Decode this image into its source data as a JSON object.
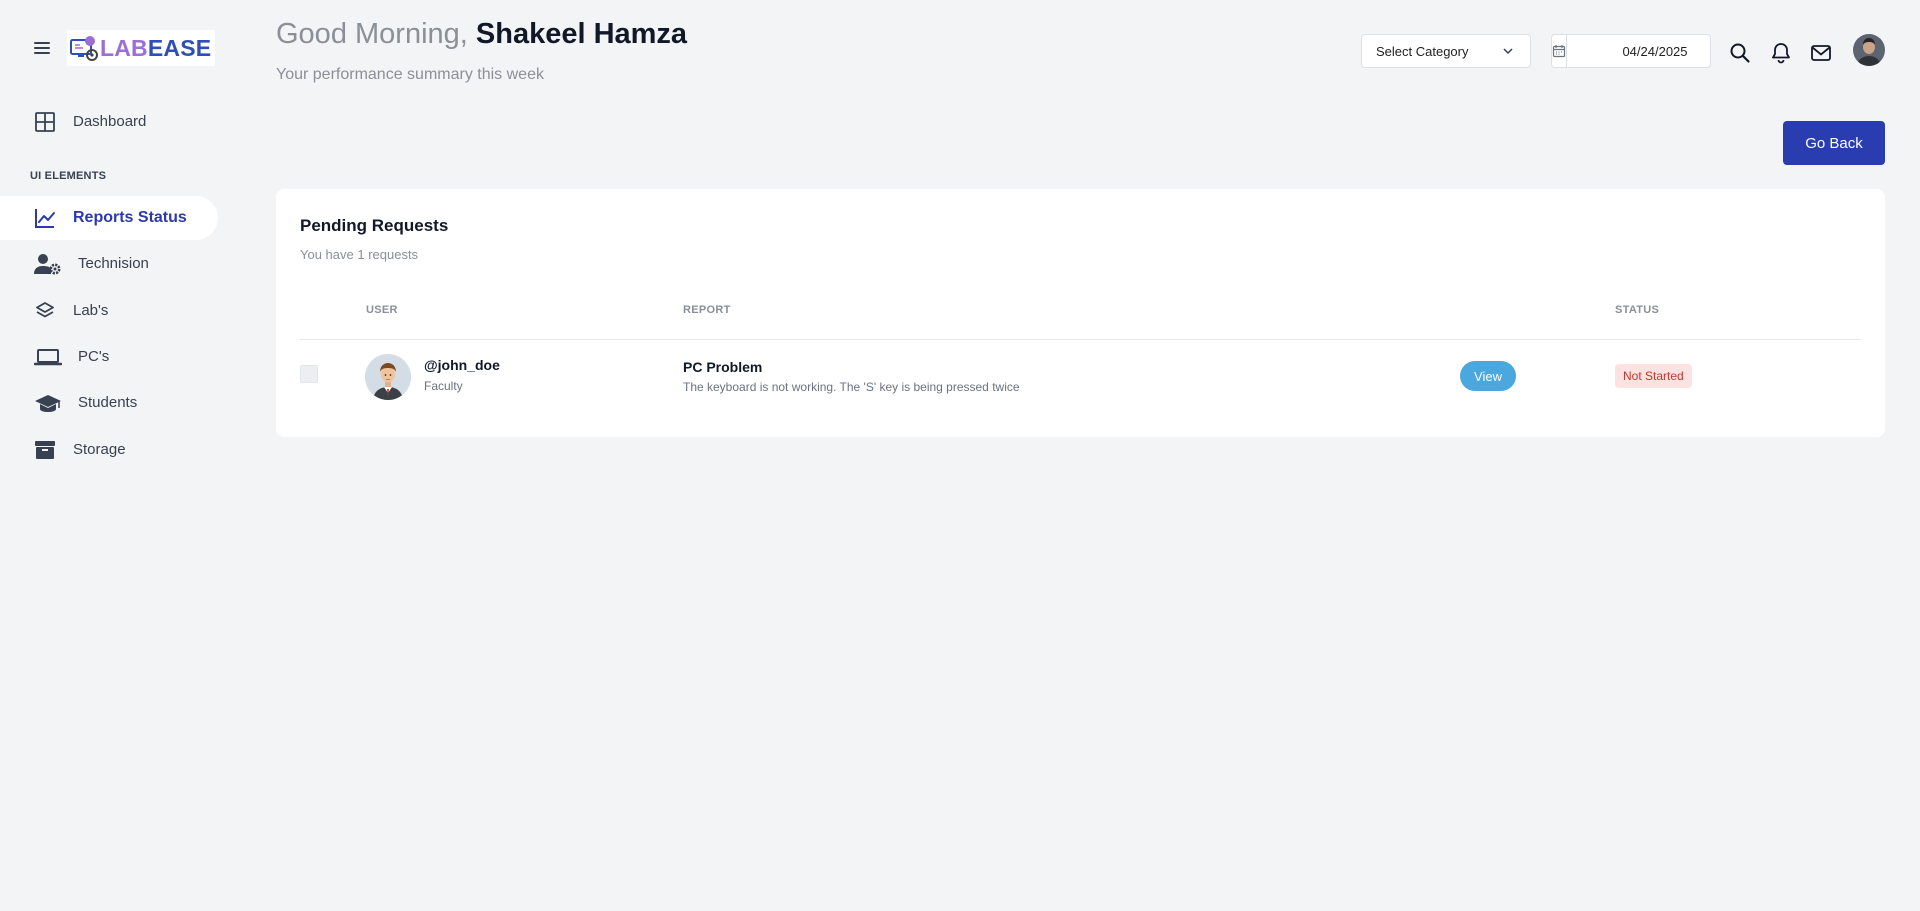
{
  "brand": {
    "logo_part1": "LAB",
    "logo_part2": "EASE",
    "colors": {
      "lab": "#9b6fd6",
      "ease": "#2f4fb6"
    }
  },
  "sidebar": {
    "section_label": "UI ELEMENTS",
    "items": [
      {
        "label": "Dashboard",
        "icon": "grid-icon",
        "active": false
      },
      {
        "label": "Reports Status",
        "icon": "line-chart-icon",
        "active": true
      },
      {
        "label": "Technision",
        "icon": "user-gear-icon",
        "active": false
      },
      {
        "label": "Lab's",
        "icon": "layers-icon",
        "active": false
      },
      {
        "label": "PC's",
        "icon": "laptop-icon",
        "active": false
      },
      {
        "label": "Students",
        "icon": "graduation-cap-icon",
        "active": false
      },
      {
        "label": "Storage",
        "icon": "archive-box-icon",
        "active": false
      }
    ]
  },
  "header": {
    "greeting": "Good Morning,",
    "user_name": "Shakeel Hamza",
    "subtitle": "Your performance summary this week",
    "category_select": "Select Category",
    "date": "04/24/2025"
  },
  "actions": {
    "go_back": "Go Back"
  },
  "card": {
    "title": "Pending Requests",
    "subtitle": "You have 1 requests",
    "columns": {
      "user": "USER",
      "report": "REPORT",
      "status": "STATUS"
    },
    "rows": [
      {
        "username": "@john_doe",
        "role": "Faculty",
        "report_title": "PC Problem",
        "report_desc": "The keyboard is not working. The 'S' key is being pressed twice",
        "action": "View",
        "status": "Not Started"
      }
    ]
  },
  "colors": {
    "accent": "#2a3db0",
    "view_button": "#4aa8df",
    "status_bg": "#fde2e2",
    "status_text": "#c0392b",
    "background": "#f3f4f6"
  }
}
